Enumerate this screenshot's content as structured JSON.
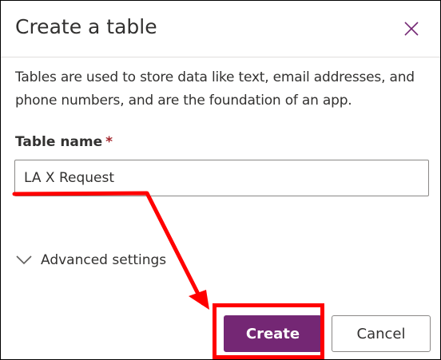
{
  "dialog": {
    "title": "Create a table",
    "close_icon": "close-icon",
    "description": "Tables are used to store data like text, email addresses, and phone numbers, and are the foundation of an app.",
    "table_name_label": "Table name",
    "required_marker": "*",
    "table_name_value": "LA X Request",
    "advanced_settings_label": "Advanced settings",
    "advanced_settings_icon": "chevron-down-icon",
    "create_label": "Create",
    "cancel_label": "Cancel"
  },
  "colors": {
    "primary": "#742774",
    "annotation": "#ff0000",
    "required": "#a4262c"
  }
}
